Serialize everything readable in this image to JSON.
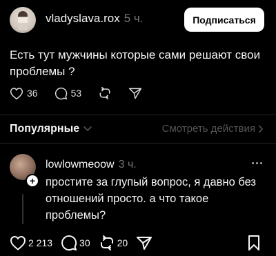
{
  "post": {
    "author": "vladyslava.rox",
    "time": "5 ч.",
    "subscribe_label": "Подписаться",
    "text": "Есть тут мужчины которые сами решают свои проблемы ?",
    "likes": "36",
    "comments": "53"
  },
  "replies_bar": {
    "sort_label": "Популярные",
    "view_activity_label": "Смотреть действия"
  },
  "reply": {
    "author": "lowlowmeoow",
    "time": "3 ч.",
    "text": "простите за глупый вопрос, я давно без отношений просто. а что такое проблемы?",
    "plus_label": "+"
  },
  "bottom_bar": {
    "likes": "2 213",
    "comments": "30",
    "reposts": "20"
  },
  "icons": {
    "like": "heart-icon",
    "comment": "comment-bubble-icon",
    "repost": "repost-arrows-icon",
    "share": "send-icon",
    "save": "bookmark-icon",
    "chevron_down": "chevron-down-icon",
    "chevron_right": "chevron-right-icon",
    "more": "more-dots-icon"
  },
  "colors": {
    "background": "#000000",
    "primary_text": "#f3f5f7",
    "secondary_text": "#777777",
    "button_bg": "#ffffff",
    "divider": "#262626"
  }
}
